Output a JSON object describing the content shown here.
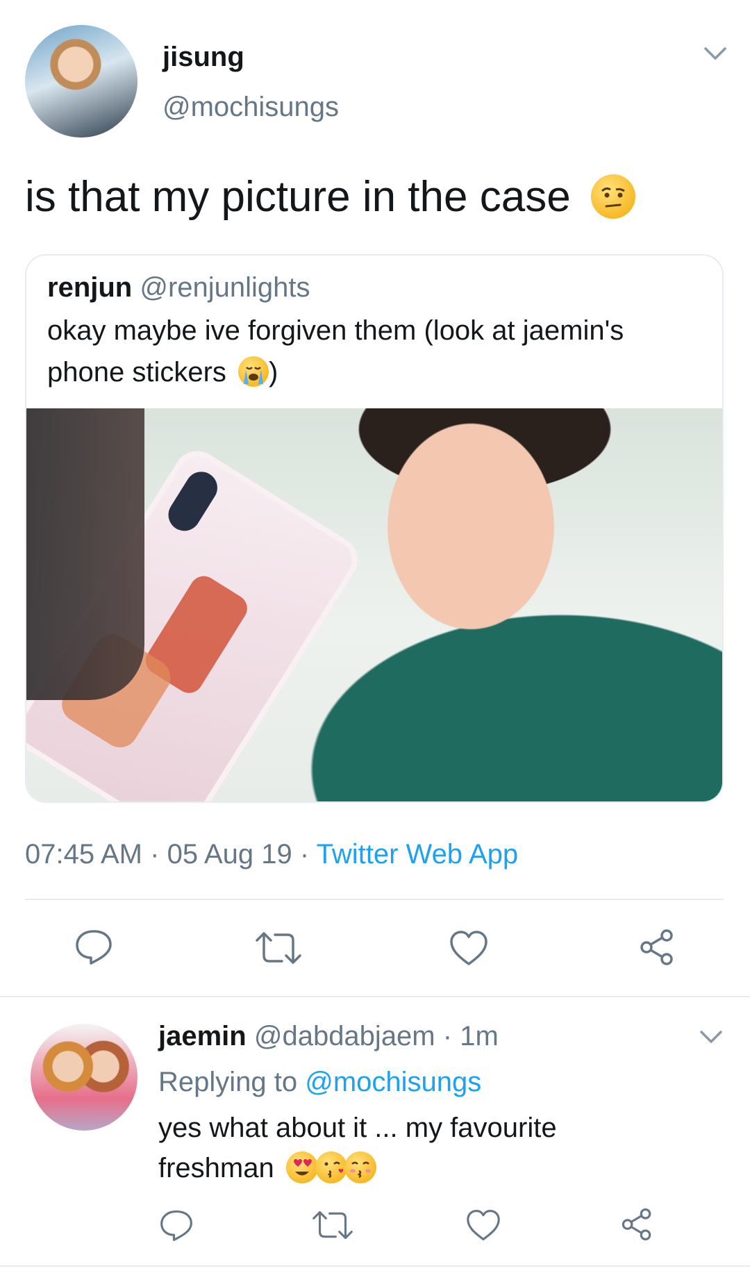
{
  "tweet": {
    "display_name": "jisung",
    "handle": "@mochisungs",
    "text": "is that my picture in the case",
    "time": "07:45 AM",
    "sep1": "·",
    "date": "05 Aug 19",
    "sep2": "·",
    "source": "Twitter Web App"
  },
  "quote": {
    "display_name": "renjun",
    "handle": "@renjunlights",
    "text_line1": "okay maybe ive forgiven them (look at jaemin's",
    "text_line2_pre": "phone stickers",
    "text_line2_post": ")"
  },
  "reply": {
    "display_name": "jaemin",
    "handle": "@dabdabjaem",
    "sep": "·",
    "time": "1m",
    "replying_prefix": "Replying to",
    "replying_handle": "@mochisungs",
    "text_line1": "yes what about it ... my favourite",
    "text_line2": "freshman"
  },
  "colors": {
    "link": "#1da1f2",
    "muted": "#657786",
    "divider": "#e6ecf0"
  },
  "icons": [
    "chevron-down-icon",
    "reply-icon",
    "retweet-icon",
    "like-icon",
    "share-icon",
    "raised-eyebrow-emoji",
    "crying-emoji",
    "heart-eyes-emoji",
    "kissing-heart-emoji",
    "kissing-closed-eyes-emoji"
  ]
}
